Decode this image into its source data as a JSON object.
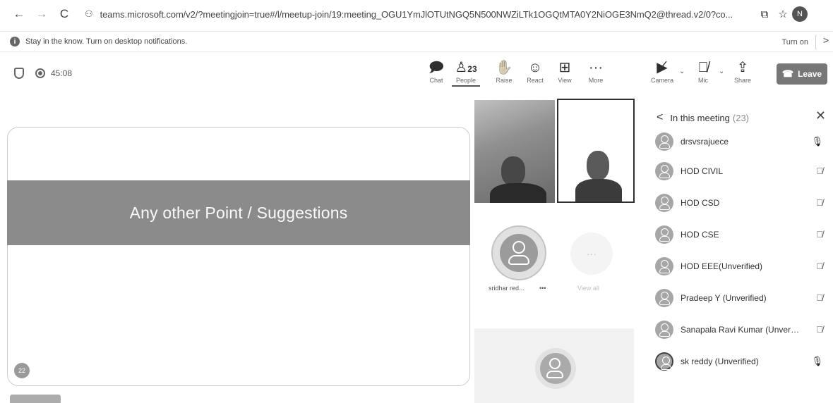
{
  "browser": {
    "back": "←",
    "forward": "→",
    "reload": "C",
    "site_icon": "⚇",
    "url": "teams.microsoft.com/v2/?meetingjoin=true#/l/meetup-join/19:meeting_OGU1YmJlOTUtNGQ5N500NWZiLTk1OGQtMTA0Y2NiOGE3NmQ2@thread.v2/0?co...",
    "profile_initial": "N"
  },
  "notification": {
    "text": "Stay in the know. Turn on desktop notifications.",
    "button": "Turn on"
  },
  "meeting": {
    "timer": "45:08"
  },
  "toolbar": {
    "chat": "Chat",
    "people": "People",
    "people_count": "23",
    "raise": "Raise",
    "react": "React",
    "view": "View",
    "more": "More",
    "camera": "Camera",
    "mic": "Mic",
    "share": "Share",
    "leave": "Leave"
  },
  "stage": {
    "slide_title": "Any other Point / Suggestions",
    "presenter_badge": "22"
  },
  "gallery": {
    "tile_name": "sridhar red...",
    "tile_more": "•••",
    "view_all": "View all"
  },
  "panel": {
    "title": "In this meeting",
    "count": "(23)",
    "participants": [
      {
        "name": "drsvsrajuece",
        "mic": "on"
      },
      {
        "name": "HOD CIVIL",
        "mic": "muted"
      },
      {
        "name": "HOD CSD",
        "mic": "muted"
      },
      {
        "name": "HOD CSE",
        "mic": "muted"
      },
      {
        "name": "HOD EEE(Unverified)",
        "mic": "muted"
      },
      {
        "name": "Pradeep Y (Unverified)",
        "mic": "muted"
      },
      {
        "name": "Sanapala Ravi Kumar (Unverifi...",
        "mic": "muted"
      },
      {
        "name": "sk reddy (Unverified)",
        "mic": "on"
      }
    ]
  }
}
